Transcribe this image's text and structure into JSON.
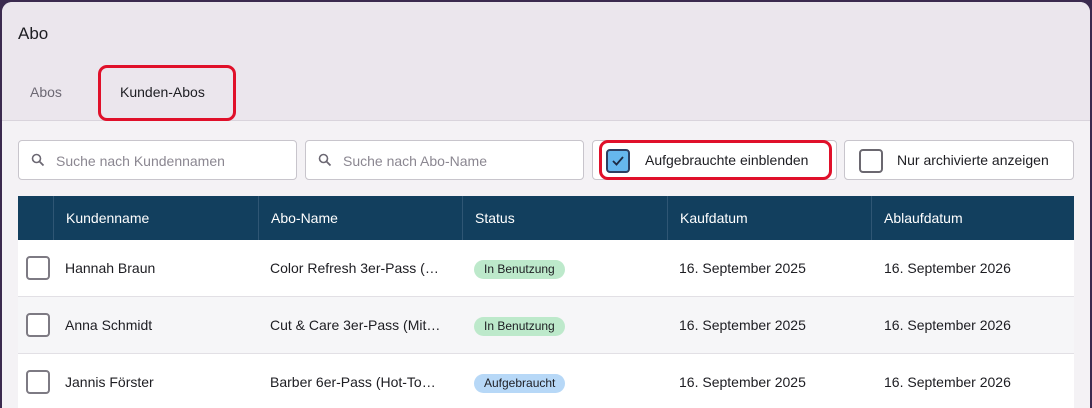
{
  "header": {
    "title": "Abo"
  },
  "tabs": [
    {
      "label": "Abos"
    },
    {
      "label": "Kunden-Abos"
    }
  ],
  "filters": {
    "customer_search_placeholder": "Suche nach Kundennamen",
    "abo_search_placeholder": "Suche nach Abo-Name",
    "show_used_label": "Aufgebrauchte einblenden",
    "show_used_checked": true,
    "archived_only_label": "Nur archivierte anzeigen",
    "archived_only_checked": false
  },
  "table": {
    "columns": [
      "Kundenname",
      "Abo-Name",
      "Status",
      "Kaufdatum",
      "Ablaufdatum"
    ],
    "rows": [
      {
        "customer": "Hannah Braun",
        "abo": "Color Refresh 3er-Pass (…",
        "status": "In Benutzung",
        "status_color": "#bde9cb",
        "purchased": "16. September 2025",
        "expires": "16. September 2026"
      },
      {
        "customer": "Anna Schmidt",
        "abo": "Cut & Care 3er-Pass (Mit…",
        "status": "In Benutzung",
        "status_color": "#bde9cb",
        "purchased": "16. September 2025",
        "expires": "16. September 2026"
      },
      {
        "customer": "Jannis Förster",
        "abo": "Barber 6er-Pass (Hot-To…",
        "status": "Aufgebraucht",
        "status_color": "#b7d8f7",
        "purchased": "16. September 2025",
        "expires": "16. September 2026"
      }
    ]
  },
  "colors": {
    "table_header": "#123f5e",
    "highlight": "#e0102a",
    "checkbox_on": "#66b7ee"
  }
}
